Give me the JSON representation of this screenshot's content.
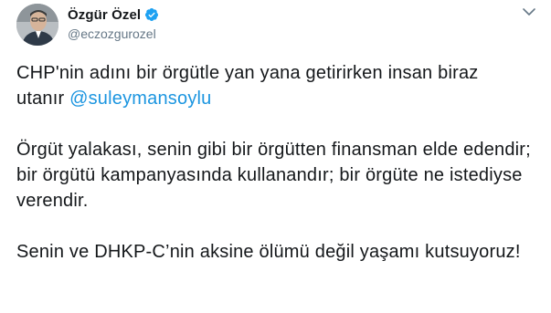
{
  "author": {
    "display_name": "Özgür Özel",
    "handle": "@eczozgurozel",
    "avatar_icon": "profile-photo",
    "verified_icon": "verified-badge-icon"
  },
  "menu_icon": "chevron-down-icon",
  "colors": {
    "text": "#14171a",
    "secondary": "#657786",
    "link": "#1b95e0",
    "verified": "#1da1f2"
  },
  "tweet": {
    "p1_line1": "CHP'nin adını bir örgütle yan yana getirirken insan biraz",
    "p1_line2_prefix": "utanır ",
    "mention": "@suleymansoylu",
    "p2": "Örgüt yalakası, senin gibi bir örgütten finansman elde edendir; bir örgütü kampanyasında kullanandır; bir örgüte ne istediyse verendir.",
    "p3": "Senin ve DHKP-C’nin aksine ölümü değil yaşamı kutsuyoruz!"
  }
}
